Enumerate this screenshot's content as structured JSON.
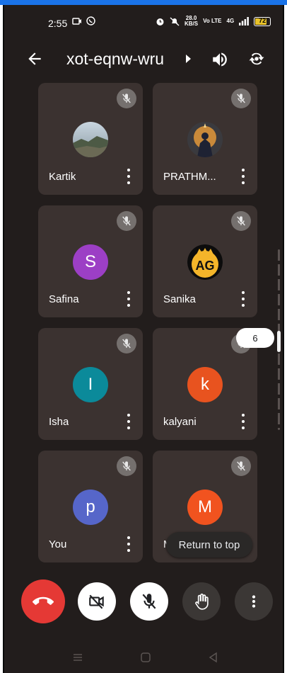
{
  "status_bar": {
    "time": "2:55",
    "speed_value": "28.0",
    "speed_unit": "KB/S",
    "network_label": "Vo LTE",
    "signal_label": "4G",
    "battery": "72"
  },
  "header": {
    "meeting_code": "xot-eqnw-wru"
  },
  "participants": [
    {
      "name": "Kartik",
      "avatar_type": "photo",
      "initial": ""
    },
    {
      "name": "PRATHM...",
      "avatar_type": "photo",
      "initial": ""
    },
    {
      "name": "Safina",
      "avatar_type": "letter",
      "initial": "S",
      "color": "#9c3fc5"
    },
    {
      "name": "Sanika",
      "avatar_type": "logo",
      "initial": "AG"
    },
    {
      "name": "Isha",
      "avatar_type": "letter",
      "initial": "I",
      "color": "#0b8a9a"
    },
    {
      "name": "kalyani",
      "avatar_type": "letter",
      "initial": "k",
      "color": "#e8531f"
    },
    {
      "name": "You",
      "avatar_type": "letter",
      "initial": "p",
      "color": "#5666c9"
    },
    {
      "name": "M",
      "avatar_type": "letter",
      "initial": "M",
      "color": "#f1531f"
    }
  ],
  "page_indicator": "6",
  "return_to_top_label": "Return to top",
  "controls": [
    {
      "name": "end-call",
      "icon": "phone-hangup-icon",
      "color": "#e53935"
    },
    {
      "name": "camera-off",
      "icon": "camera-off-icon",
      "color": "#ffffff"
    },
    {
      "name": "mic-off",
      "icon": "mic-off-icon",
      "color": "#ffffff"
    },
    {
      "name": "raise-hand",
      "icon": "hand-icon",
      "color": "#3b3735"
    },
    {
      "name": "more-options",
      "icon": "more-vert-icon",
      "color": "#3b3735"
    }
  ]
}
